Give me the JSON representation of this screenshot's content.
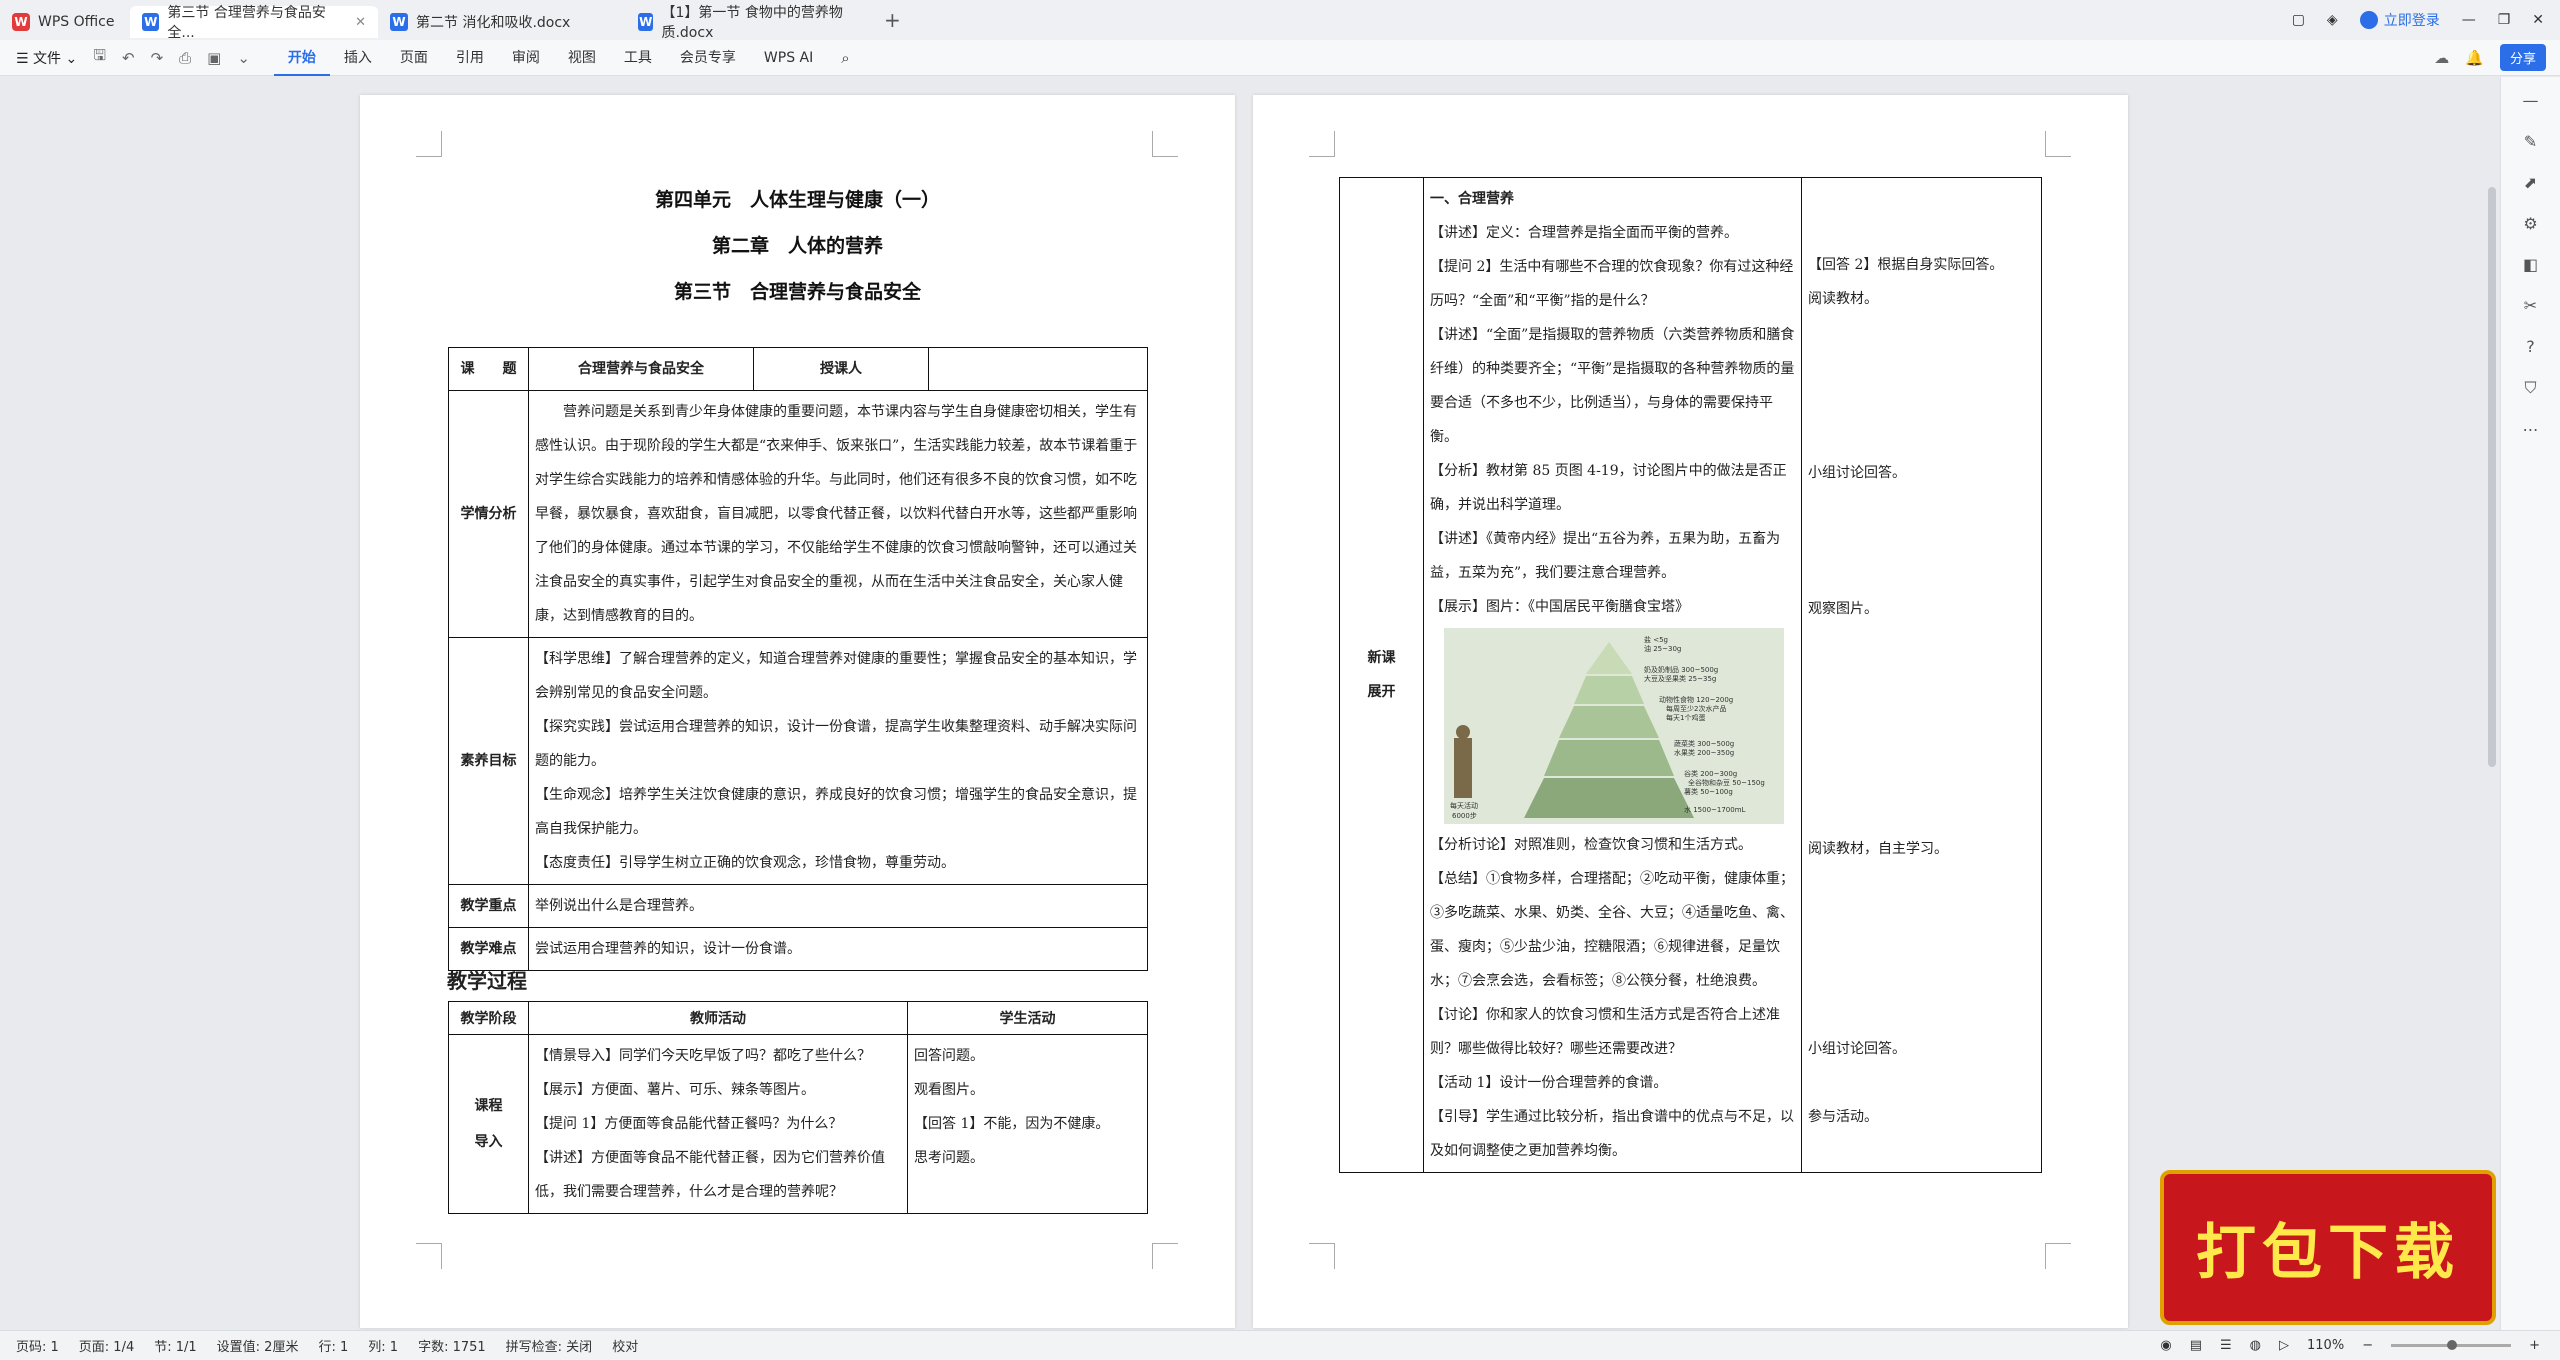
{
  "tabs": [
    {
      "label": "WPS Office"
    },
    {
      "label": "第三节 合理营养与食品安全..."
    },
    {
      "label": "第二节 消化和吸收.docx"
    },
    {
      "label": "【1】第一节 食物中的营养物质.docx"
    }
  ],
  "titlebar": {
    "login": "立即登录"
  },
  "ribbon": {
    "file": "文件",
    "menu": [
      "开始",
      "插入",
      "页面",
      "引用",
      "审阅",
      "视图",
      "工具",
      "会员专享",
      "WPS AI"
    ],
    "share": "分享"
  },
  "page1": {
    "title1": "第四单元　人体生理与健康（一）",
    "title2": "第二章　人体的营养",
    "title3": "第三节　合理营养与食品安全",
    "lesson": {
      "topic_label": "课　　题",
      "topic": "合理营养与食品安全",
      "teacher_label": "授课人",
      "teacher": "",
      "analysis_label": "学情分析",
      "analysis": "营养问题是关系到青少年身体健康的重要问题，本节课内容与学生自身健康密切相关，学生有感性认识。由于现阶段的学生大都是“衣来伸手、饭来张口”，生活实践能力较差，故本节课着重于对学生综合实践能力的培养和情感体验的升华。与此同时，他们还有很多不良的饮食习惯，如不吃早餐，暴饮暴食，喜欢甜食，盲目减肥，以零食代替正餐，以饮料代替白开水等，这些都严重影响了他们的身体健康。通过本节课的学习，不仅能给学生不健康的饮食习惯敲响警钟，还可以通过关注食品安全的真实事件，引起学生对食品安全的重视，从而在生活中关注食品安全，关心家人健康，达到情感教育的目的。",
      "goals_label": "素养目标",
      "goals": [
        "【科学思维】了解合理营养的定义，知道合理营养对健康的重要性；掌握食品安全的基本知识，学会辨别常见的食品安全问题。",
        "【探究实践】尝试运用合理营养的知识，设计一份食谱，提高学生收集整理资料、动手解决实际问题的能力。",
        "【生命观念】培养学生关注饮食健康的意识，养成良好的饮食习惯；增强学生的食品安全意识，提高自我保护能力。",
        "【态度责任】引导学生树立正确的饮食观念，珍惜食物，尊重劳动。"
      ],
      "key_label": "教学重点",
      "key": "举例说出什么是合理营养。",
      "difficult_label": "教学难点",
      "difficult": "尝试运用合理营养的知识，设计一份食谱。"
    },
    "process_heading": "教学过程",
    "process": {
      "headers": [
        "教学阶段",
        "教师活动",
        "学生活动"
      ],
      "stage": "课程\n导入",
      "teacher": [
        "【情景导入】同学们今天吃早饭了吗？都吃了些什么？",
        "【展示】方便面、薯片、可乐、辣条等图片。",
        "【提问 1】方便面等食品能代替正餐吗？为什么？",
        "【讲述】方便面等食品不能代替正餐，因为它们营养价值低，我们需要合理营养，什么才是合理的营养呢？"
      ],
      "student": [
        "回答问题。",
        "观看图片。",
        "【回答 1】不能，因为不健康。",
        "思考问题。"
      ]
    }
  },
  "page2": {
    "stage": "新课\n展开",
    "teacher": [
      "一、合理营养",
      "【讲述】定义：合理营养是指全面而平衡的营养。",
      "【提问 2】生活中有哪些不合理的饮食现象？你有过这种经历吗？“全面”和“平衡”指的是什么？",
      "【讲述】“全面”是指摄取的营养物质（六类营养物质和膳食纤维）的种类要齐全；“平衡”是指摄取的各种营养物质的量要合适（不多也不少，比例适当），与身体的需要保持平衡。",
      "【分析】教材第 85 页图 4-19，讨论图片中的做法是否正确，并说出科学道理。",
      "【讲述】《黄帝内经》提出“五谷为养，五果为助，五畜为益，五菜为充”，我们要注意合理营养。",
      "【展示】图片：《中国居民平衡膳食宝塔》",
      "【分析讨论】对照准则，检查饮食习惯和生活方式。",
      "【总结】①食物多样，合理搭配；②吃动平衡，健康体重；③多吃蔬菜、水果、奶类、全谷、大豆；④适量吃鱼、禽、蛋、瘦肉；⑤少盐少油，控糖限酒；⑥规律进餐，足量饮水；⑦会烹会选，会看标签；⑧公筷分餐，杜绝浪费。",
      "【讨论】你和家人的饮食习惯和生活方式是否符合上述准则？哪些做得比较好？哪些还需要改进？",
      "【活动 1】设计一份合理营养的食谱。",
      "【引导】学生通过比较分析，指出食谱中的优点与不足，以及如何调整使之更加营养均衡。"
    ],
    "student": [
      {
        "text": "【回答 2】根据自身实际回答。"
      },
      {
        "text": "阅读教材。"
      },
      {
        "text": "小组讨论回答。"
      },
      {
        "text": "观察图片。"
      },
      {
        "text": "阅读教材，自主学习。"
      },
      {
        "text": "小组讨论回答。"
      },
      {
        "text": "参与活动。"
      }
    ],
    "pyramid": {
      "labels": [
        "盐 <5g",
        "油 25~30g",
        "奶及奶制品 300~500g",
        "大豆及坚果类 25~35g",
        "动物性食物 120~200g",
        "每周至少2次水产品",
        "每天1个鸡蛋",
        "蔬菜类 300~500g",
        "水果类 200~350g",
        "谷类 200~300g",
        "全谷物和杂豆 50~150g",
        "薯类 50~100g",
        "水 1500~1700mL",
        "每天活动",
        "6000步"
      ]
    }
  },
  "status": {
    "page": "页码: 1",
    "pages": "页面: 1/4",
    "section": "节: 1/1",
    "setting": "设置值: 2厘米",
    "row": "行: 1",
    "col": "列: 1",
    "words": "字数: 1751",
    "spell": "拼写检查: 关闭",
    "proof": "校对",
    "zoom": "110%"
  },
  "promo": "打包下载"
}
